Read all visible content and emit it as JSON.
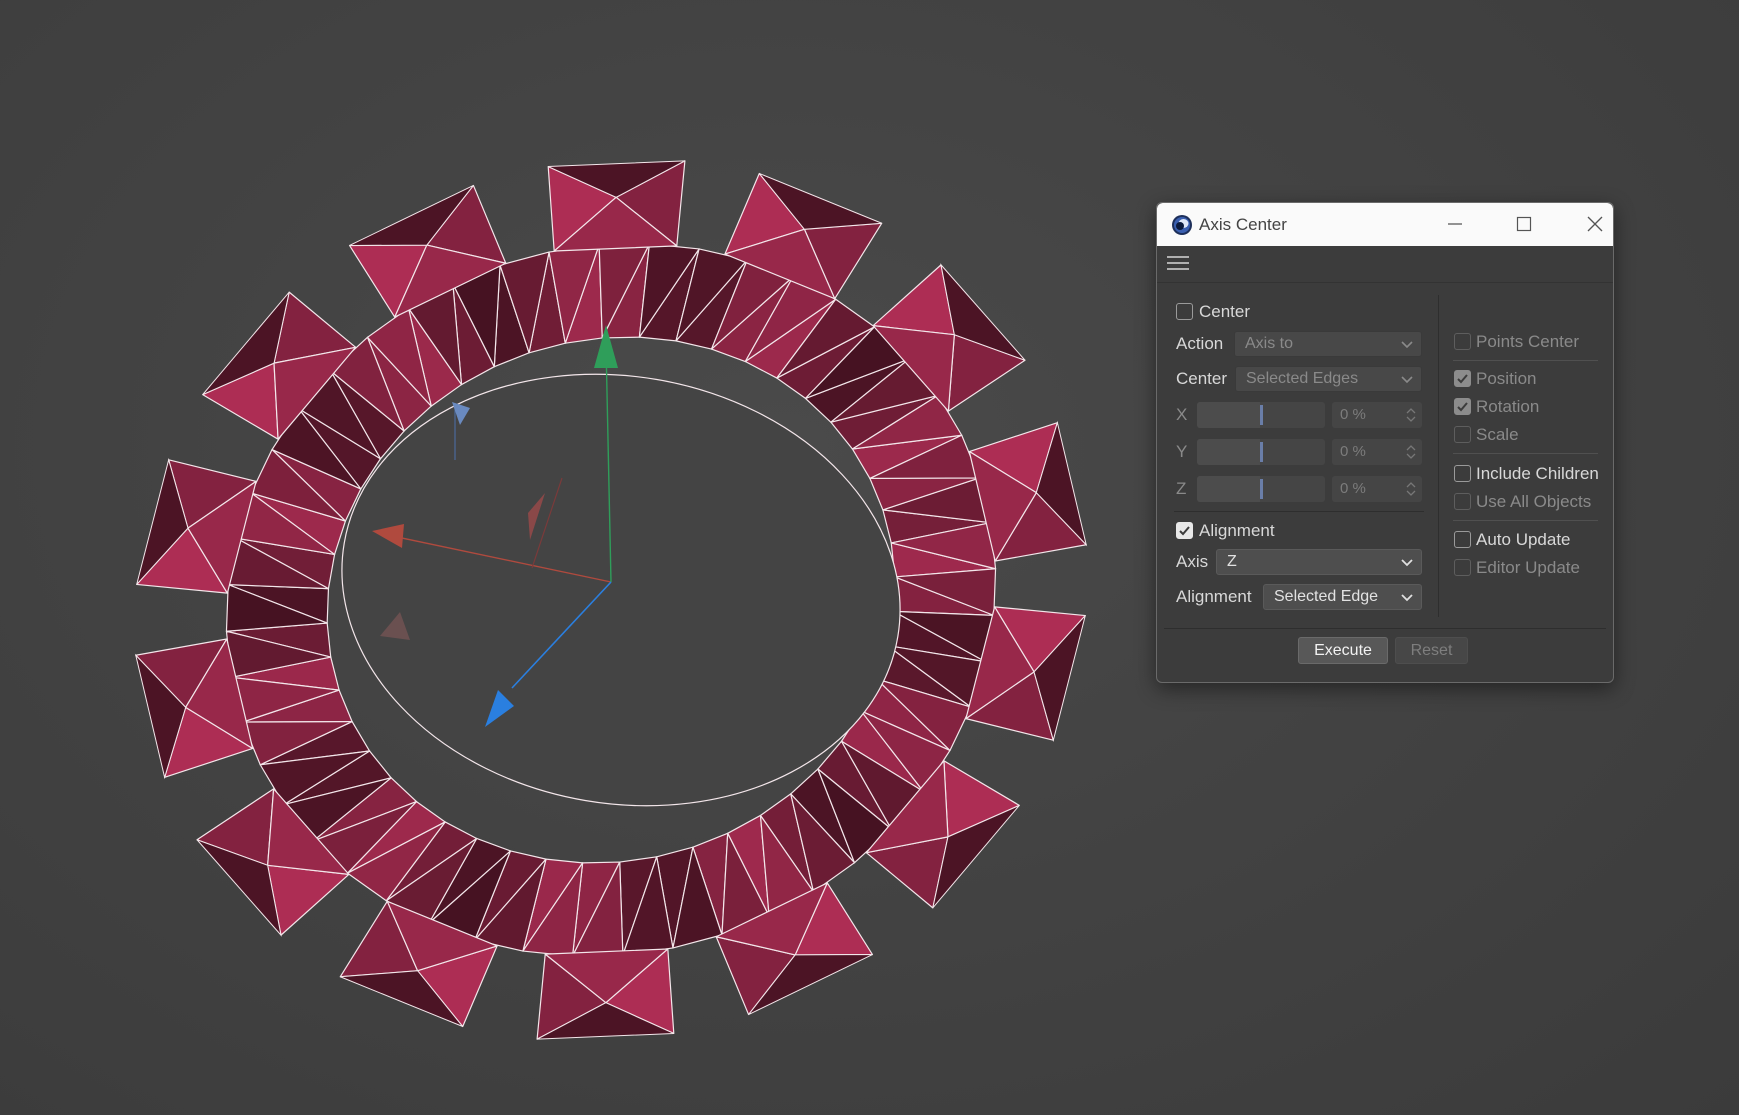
{
  "window": {
    "title": "Axis Center",
    "controls": {
      "minimize": "minimize-icon",
      "maximize": "maximize-icon",
      "close": "close-icon"
    }
  },
  "toolbar": {
    "menu_icon": "hamburger-menu-icon"
  },
  "left": {
    "center": {
      "label": "Center",
      "checked": false
    },
    "action": {
      "label": "Action",
      "value": "Axis to"
    },
    "center_mode": {
      "label": "Center",
      "value": "Selected Edges"
    },
    "axes": [
      {
        "label": "X",
        "value": "0 %",
        "fraction": 0.5
      },
      {
        "label": "Y",
        "value": "0 %",
        "fraction": 0.5
      },
      {
        "label": "Z",
        "value": "0 %",
        "fraction": 0.5
      }
    ],
    "alignment": {
      "label": "Alignment",
      "checked": true
    },
    "axis": {
      "label": "Axis",
      "value": "Z"
    },
    "alignment_mode": {
      "label": "Alignment",
      "value": "Selected Edge"
    }
  },
  "right": {
    "points_center": {
      "label": "Points Center",
      "checked": false,
      "enabled": false
    },
    "position": {
      "label": "Position",
      "checked": true,
      "enabled": false
    },
    "rotation": {
      "label": "Rotation",
      "checked": true,
      "enabled": false
    },
    "scale": {
      "label": "Scale",
      "checked": false,
      "enabled": false
    },
    "include_children": {
      "label": "Include Children",
      "checked": false,
      "enabled": true
    },
    "use_all_objects": {
      "label": "Use All Objects",
      "checked": false,
      "enabled": false
    },
    "auto_update": {
      "label": "Auto Update",
      "checked": false,
      "enabled": true
    },
    "editor_update": {
      "label": "Editor Update",
      "checked": false,
      "enabled": false
    }
  },
  "footer": {
    "execute": "Execute",
    "reset": "Reset"
  },
  "colors": {
    "background": "#434343",
    "mesh_fill": "#8a2443",
    "mesh_wire": "#f3e6ea",
    "axis_x": "#b04a3e",
    "axis_y": "#2f9e5a",
    "axis_z": "#2a7fe0",
    "dialog_bg": "#3c3c3c",
    "titlebar_bg": "#fafafa"
  }
}
